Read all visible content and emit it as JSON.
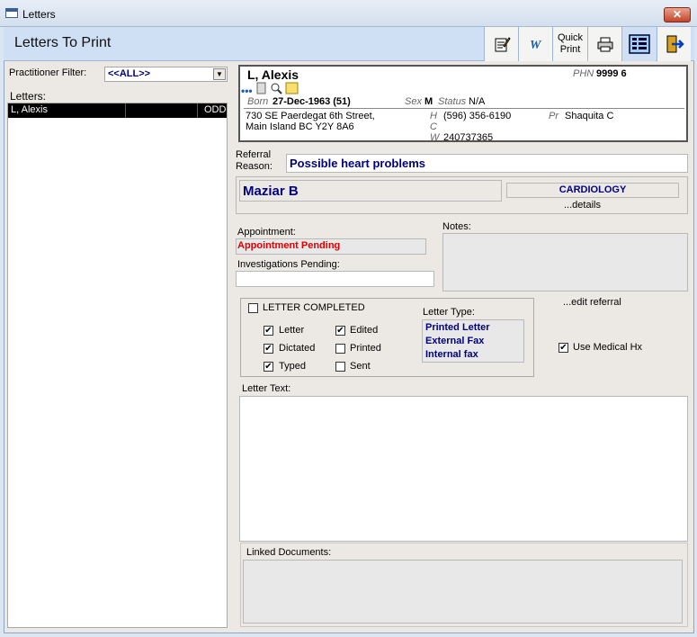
{
  "window": {
    "title": "Letters",
    "close": "✕"
  },
  "header": {
    "title": "Letters To Print",
    "quick_print_1": "Quick",
    "quick_print_2": "Print"
  },
  "left": {
    "filter_label": "Practitioner Filter:",
    "filter_value": "<<ALL>>",
    "letters_label": "Letters:",
    "rows": [
      {
        "name": "L, Alexis",
        "code": "ODD"
      }
    ]
  },
  "patient": {
    "name": "L, Alexis",
    "phn_label": "PHN",
    "phn": "9999 6",
    "born_label": "Born",
    "born": "27-Dec-1963 (51)",
    "sex_label": "Sex",
    "sex": "M",
    "status_label": "Status",
    "status": "N/A",
    "address_1": "730 SE Paerdegat 6th Street,",
    "address_2": "Main Island BC  Y2Y 8A6",
    "h_label": "H",
    "h_phone": "(596) 356-6190",
    "c_label": "C",
    "w_label": "W",
    "w_phone": "240737365",
    "pr_label": "Pr",
    "pr_name": "Shaquita C"
  },
  "referral": {
    "label_1": "Referral",
    "label_2": "Reason:",
    "reason": "Possible heart problems",
    "doctor": "Maziar B",
    "specialty": "CARDIOLOGY",
    "details_link": "...details",
    "edit_link": "...edit referral"
  },
  "appointment": {
    "label": "Appointment:",
    "value": "Appointment Pending",
    "investigations_label": "Investigations Pending:",
    "investigations_value": ""
  },
  "notes": {
    "label": "Notes:"
  },
  "letter_status": {
    "completed_label": "LETTER COMPLETED",
    "items": [
      {
        "label": "Letter",
        "checked": true
      },
      {
        "label": "Edited",
        "checked": true
      },
      {
        "label": "Dictated",
        "checked": true
      },
      {
        "label": "Printed",
        "checked": false
      },
      {
        "label": "Typed",
        "checked": true
      },
      {
        "label": "Sent",
        "checked": false
      }
    ],
    "type_label": "Letter Type:",
    "types": [
      "Printed Letter",
      "External Fax",
      "Internal fax"
    ]
  },
  "use_medical_hx": "Use Medical Hx",
  "letter_text": {
    "label": "Letter Text:"
  },
  "linked_documents": {
    "label": "Linked Documents:"
  },
  "colors": {
    "header_bg": "#cfe0f5",
    "navy": "#000080",
    "red": "#e00000"
  }
}
